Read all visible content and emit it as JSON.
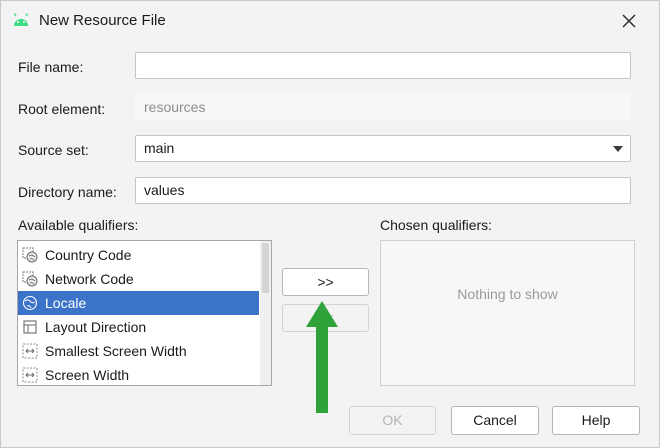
{
  "dialog": {
    "title": "New Resource File",
    "close_icon": "close-icon",
    "app_icon": "android-icon"
  },
  "form": {
    "file_name_label": "File name:",
    "file_name_value": "",
    "root_element_label": "Root element:",
    "root_element_placeholder": "resources",
    "source_set_label": "Source set:",
    "source_set_value": "main",
    "directory_name_label": "Directory name:",
    "directory_name_value": "values"
  },
  "qualifiers": {
    "available_label": "Available qualifiers:",
    "chosen_label": "Chosen qualifiers:",
    "items": [
      {
        "label": "Country Code",
        "icon": "country-code-icon",
        "selected": false
      },
      {
        "label": "Network Code",
        "icon": "network-code-icon",
        "selected": false
      },
      {
        "label": "Locale",
        "icon": "globe-icon",
        "selected": true
      },
      {
        "label": "Layout Direction",
        "icon": "layout-direction-icon",
        "selected": false
      },
      {
        "label": "Smallest Screen Width",
        "icon": "screen-width-icon",
        "selected": false
      },
      {
        "label": "Screen Width",
        "icon": "screen-width-icon",
        "selected": false
      }
    ],
    "add_button": ">>",
    "remove_button": "<<",
    "chosen_empty": "Nothing to show"
  },
  "footer": {
    "ok": "OK",
    "cancel": "Cancel",
    "help": "Help"
  },
  "colors": {
    "selection": "#3b73c9",
    "annotation_arrow": "#2fa33a",
    "android_green": "#3ddc84"
  }
}
